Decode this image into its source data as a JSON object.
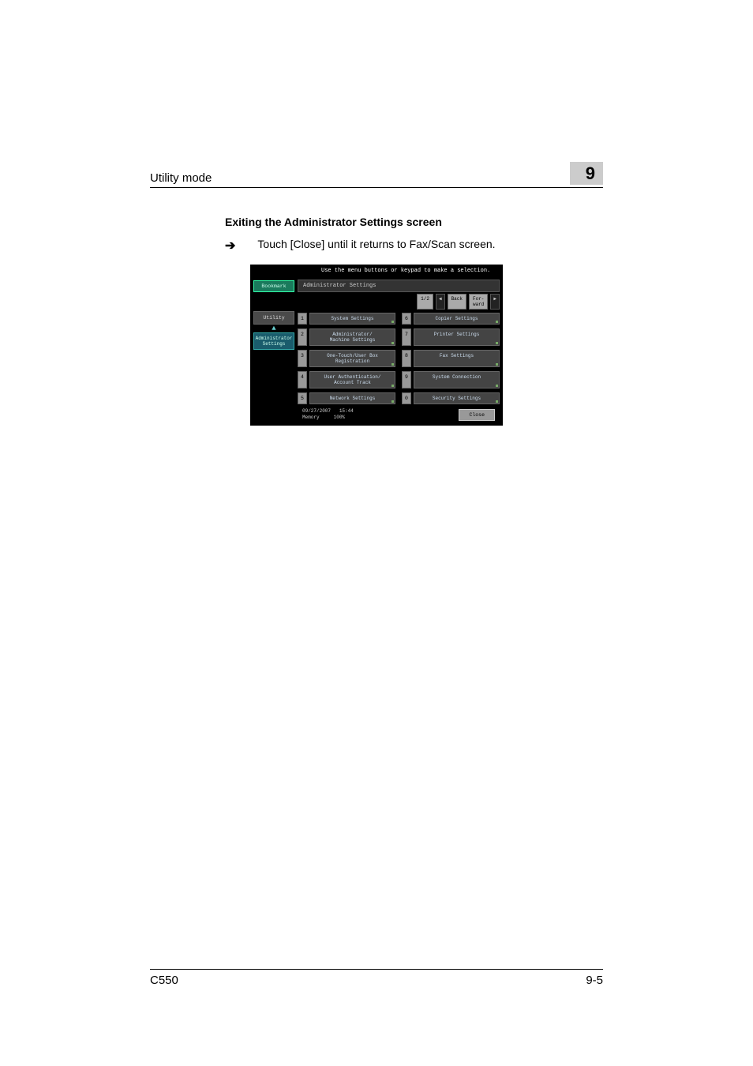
{
  "header": {
    "title": "Utility mode",
    "chapter": "9"
  },
  "section_title": "Exiting the Administrator Settings screen",
  "instruction": "Touch [Close] until it returns to Fax/Scan screen.",
  "screenshot": {
    "top_instruction": "Use the menu buttons or keypad to make a selection.",
    "bookmark_label": "Bookmark",
    "utility_label": "Utility",
    "admin_label": "Administrator Settings",
    "panel_title": "Administrator Settings",
    "pager": "1/2",
    "back_label": "Back",
    "forward_label": "For-\nward",
    "menu": [
      {
        "num": "1",
        "label": "System Settings"
      },
      {
        "num": "6",
        "label": "Copier Settings"
      },
      {
        "num": "2",
        "label": "Administrator/\nMachine Settings"
      },
      {
        "num": "7",
        "label": "Printer Settings"
      },
      {
        "num": "3",
        "label": "One-Touch/User Box\nRegistration"
      },
      {
        "num": "8",
        "label": "Fax Settings"
      },
      {
        "num": "4",
        "label": "User Authentication/\nAccount Track"
      },
      {
        "num": "9",
        "label": "System Connection"
      },
      {
        "num": "5",
        "label": "Network Settings"
      },
      {
        "num": "0",
        "label": "Security Settings"
      }
    ],
    "date": "09/27/2007",
    "time": "15:44",
    "memory_label": "Memory",
    "memory_value": "100%",
    "close_label": "Close"
  },
  "footer": {
    "model": "C550",
    "page": "9-5"
  }
}
